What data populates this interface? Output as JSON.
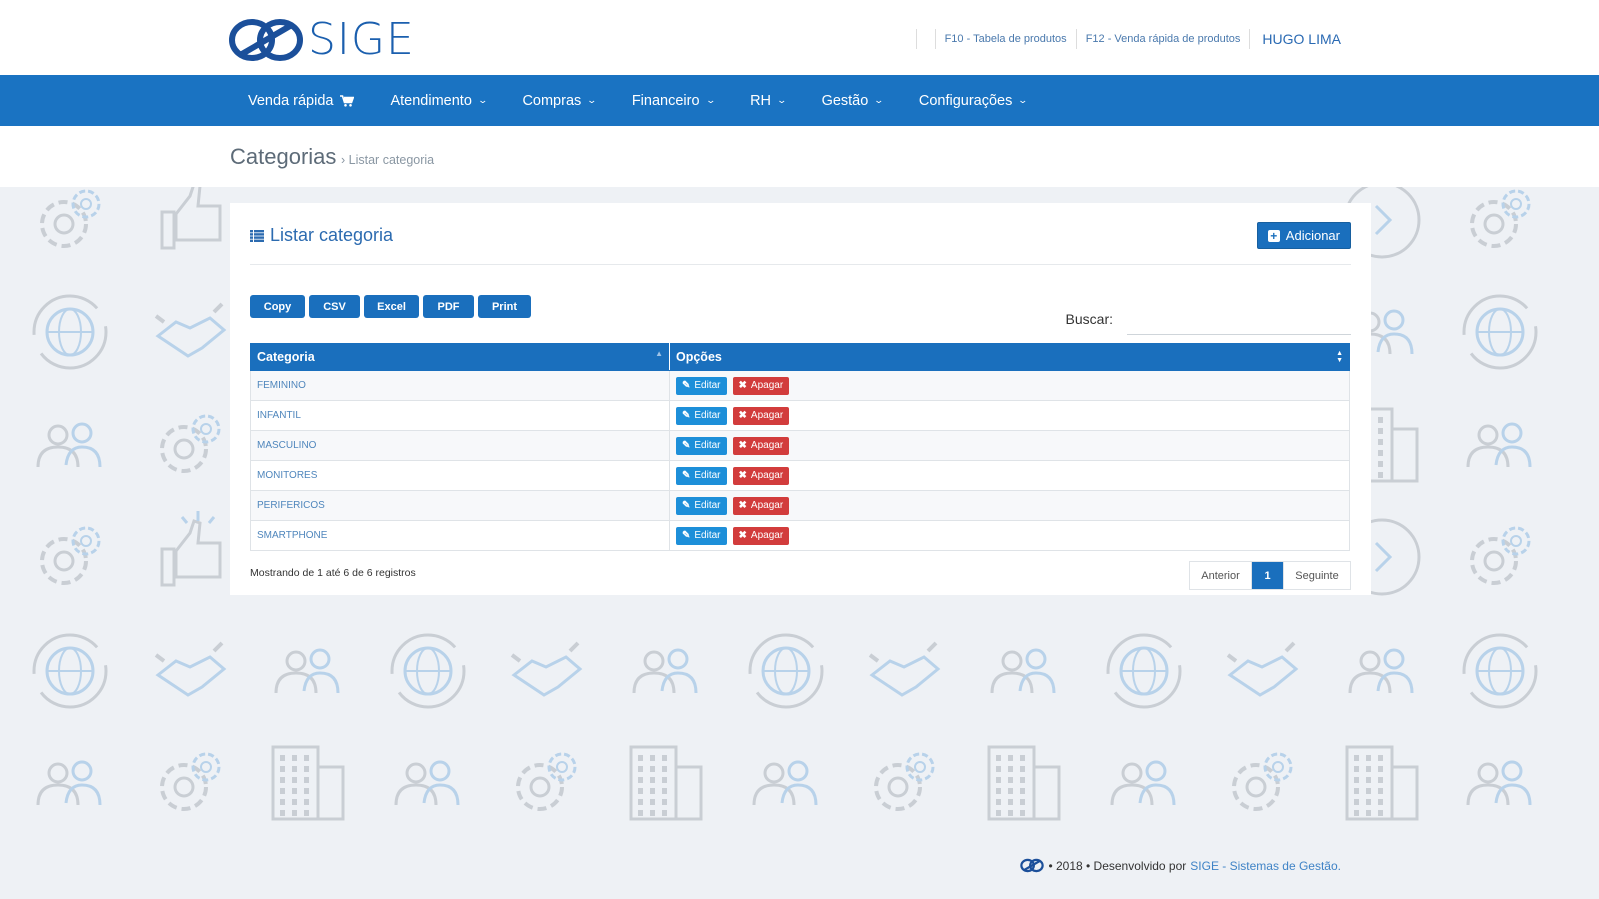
{
  "brand": {
    "logo_text": "SIGE"
  },
  "shortcuts": {
    "f10": "F10 - Tabela de produtos",
    "f12": "F12 - Venda rápida de produtos",
    "user": "HUGO LIMA"
  },
  "nav": [
    {
      "label": "Venda rápida",
      "icon": "cart-icon"
    },
    {
      "label": "Atendimento",
      "icon": "chevron-down-icon"
    },
    {
      "label": "Compras",
      "icon": "chevron-down-icon"
    },
    {
      "label": "Financeiro",
      "icon": "chevron-down-icon"
    },
    {
      "label": "RH",
      "icon": "chevron-down-icon"
    },
    {
      "label": "Gestão",
      "icon": "chevron-down-icon"
    },
    {
      "label": "Configurações",
      "icon": "chevron-down-icon"
    }
  ],
  "page": {
    "title": "Categorias",
    "crumb_sep": "›",
    "crumb": "Listar categoria"
  },
  "card": {
    "title": "Listar categoria",
    "add_label": "Adicionar"
  },
  "export": [
    "Copy",
    "CSV",
    "Excel",
    "PDF",
    "Print"
  ],
  "search": {
    "label": "Buscar:",
    "value": ""
  },
  "table": {
    "headers": [
      "Categoria",
      "Opções"
    ],
    "rows": [
      "FEMININO",
      "INFANTIL",
      "MASCULINO",
      "MONITORES",
      "PERIFERICOS",
      "SMARTPHONE"
    ],
    "edit_label": "Editar",
    "delete_label": "Apagar"
  },
  "info": "Mostrando de 1 até 6 de 6 registros",
  "pagination": {
    "prev": "Anterior",
    "current": "1",
    "next": "Seguinte"
  },
  "footer": {
    "text": "• 2018 • Desenvolvido por",
    "brand": "SIGE - Sistemas de Gestão."
  },
  "colors": {
    "primary": "#1a73c2",
    "danger": "#d23c3c",
    "info": "#1d8fd9",
    "background": "#eef1f5"
  }
}
